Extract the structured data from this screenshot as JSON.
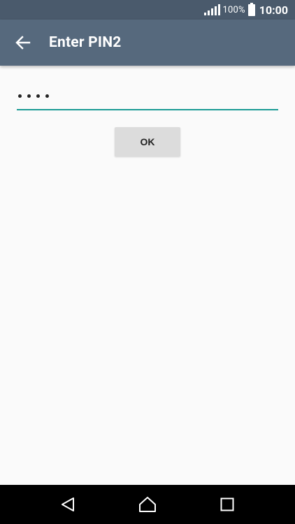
{
  "status_bar": {
    "battery_percent": "100%",
    "time": "10:00",
    "signal_icon": "signal-icon",
    "battery_icon": "battery-icon"
  },
  "app_bar": {
    "back_icon": "back-arrow-icon",
    "title": "Enter PIN2"
  },
  "pin_input": {
    "masked_length": 4,
    "underline_color": "#1a9b94"
  },
  "ok_button": {
    "label": "OK"
  },
  "nav_bar": {
    "back_icon": "nav-back-icon",
    "home_icon": "nav-home-icon",
    "recents_icon": "nav-recents-icon"
  },
  "colors": {
    "status_bar": "#4a5a6c",
    "app_bar": "#56697d",
    "background": "#fafafa",
    "accent": "#1a9b94"
  }
}
